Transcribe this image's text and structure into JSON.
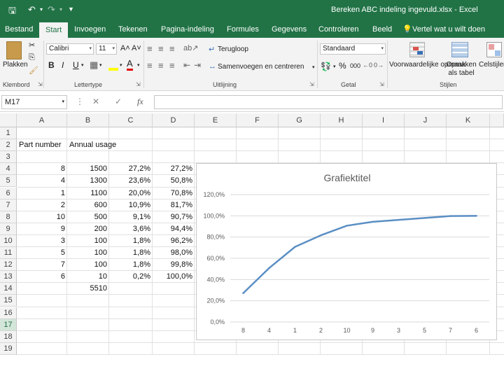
{
  "window": {
    "title": "Bereken ABC indeling ingevuld.xlsx - Excel"
  },
  "tabs": [
    {
      "label": "Bestand"
    },
    {
      "label": "Start"
    },
    {
      "label": "Invoegen"
    },
    {
      "label": "Tekenen"
    },
    {
      "label": "Pagina-indeling"
    },
    {
      "label": "Formules"
    },
    {
      "label": "Gegevens"
    },
    {
      "label": "Controleren"
    },
    {
      "label": "Beeld"
    },
    {
      "label": "Vertel wat u wilt doen"
    }
  ],
  "ribbon": {
    "paste": "Plakken",
    "font_name": "Calibri",
    "font_size": "11",
    "bold": "B",
    "italic": "I",
    "underline": "U",
    "wrap_text": "Terugloop",
    "merge_center": "Samenvoegen en centreren",
    "number_format": "Standaard",
    "percent": "%",
    "thousands": "000",
    "cond_format": "Voorwaardelijke opmaak",
    "format_table": "Opmaken als tabel",
    "cell_styles": "Celstijlen",
    "groups": {
      "clipboard": "Klembord",
      "font": "Lettertype",
      "alignment": "Uitlijning",
      "number": "Getal",
      "styles": "Stijlen"
    }
  },
  "formula_bar": {
    "name_box": "M17",
    "cancel": "✕",
    "confirm": "✓",
    "fx": "fx",
    "formula": ""
  },
  "columns": [
    "A",
    "B",
    "C",
    "D",
    "E",
    "F",
    "G",
    "H",
    "I",
    "J",
    "K"
  ],
  "rows": [
    "1",
    "2",
    "3",
    "4",
    "5",
    "6",
    "7",
    "8",
    "9",
    "10",
    "11",
    "12",
    "13",
    "14",
    "15",
    "16",
    "17",
    "18",
    "19"
  ],
  "cells": {
    "header_part": "Part number",
    "header_usage": "Annual usage",
    "data": [
      {
        "a": "8",
        "b": "1500",
        "c": "27,2%",
        "d": "27,2%"
      },
      {
        "a": "4",
        "b": "1300",
        "c": "23,6%",
        "d": "50,8%"
      },
      {
        "a": "1",
        "b": "1100",
        "c": "20,0%",
        "d": "70,8%"
      },
      {
        "a": "2",
        "b": "600",
        "c": "10,9%",
        "d": "81,7%"
      },
      {
        "a": "10",
        "b": "500",
        "c": "9,1%",
        "d": "90,7%"
      },
      {
        "a": "9",
        "b": "200",
        "c": "3,6%",
        "d": "94,4%"
      },
      {
        "a": "3",
        "b": "100",
        "c": "1,8%",
        "d": "96,2%"
      },
      {
        "a": "5",
        "b": "100",
        "c": "1,8%",
        "d": "98,0%"
      },
      {
        "a": "7",
        "b": "100",
        "c": "1,8%",
        "d": "99,8%"
      },
      {
        "a": "6",
        "b": "10",
        "c": "0,2%",
        "d": "100,0%"
      }
    ],
    "total": "5510"
  },
  "colors": {
    "excel_green": "#217346",
    "series": "#5b8fc4"
  },
  "chart_data": {
    "type": "line",
    "title": "Grafiektitel",
    "categories": [
      "8",
      "4",
      "1",
      "2",
      "10",
      "9",
      "3",
      "5",
      "7",
      "6"
    ],
    "series": [
      {
        "values": [
          27.2,
          50.8,
          70.8,
          81.7,
          90.7,
          94.4,
          96.2,
          98.0,
          99.8,
          100.0
        ]
      }
    ],
    "ylim": [
      0,
      120
    ],
    "yticks": [
      "0,0%",
      "20,0%",
      "40,0%",
      "60,0%",
      "80,0%",
      "100,0%",
      "120,0%"
    ],
    "grid": true,
    "legend": "none"
  }
}
